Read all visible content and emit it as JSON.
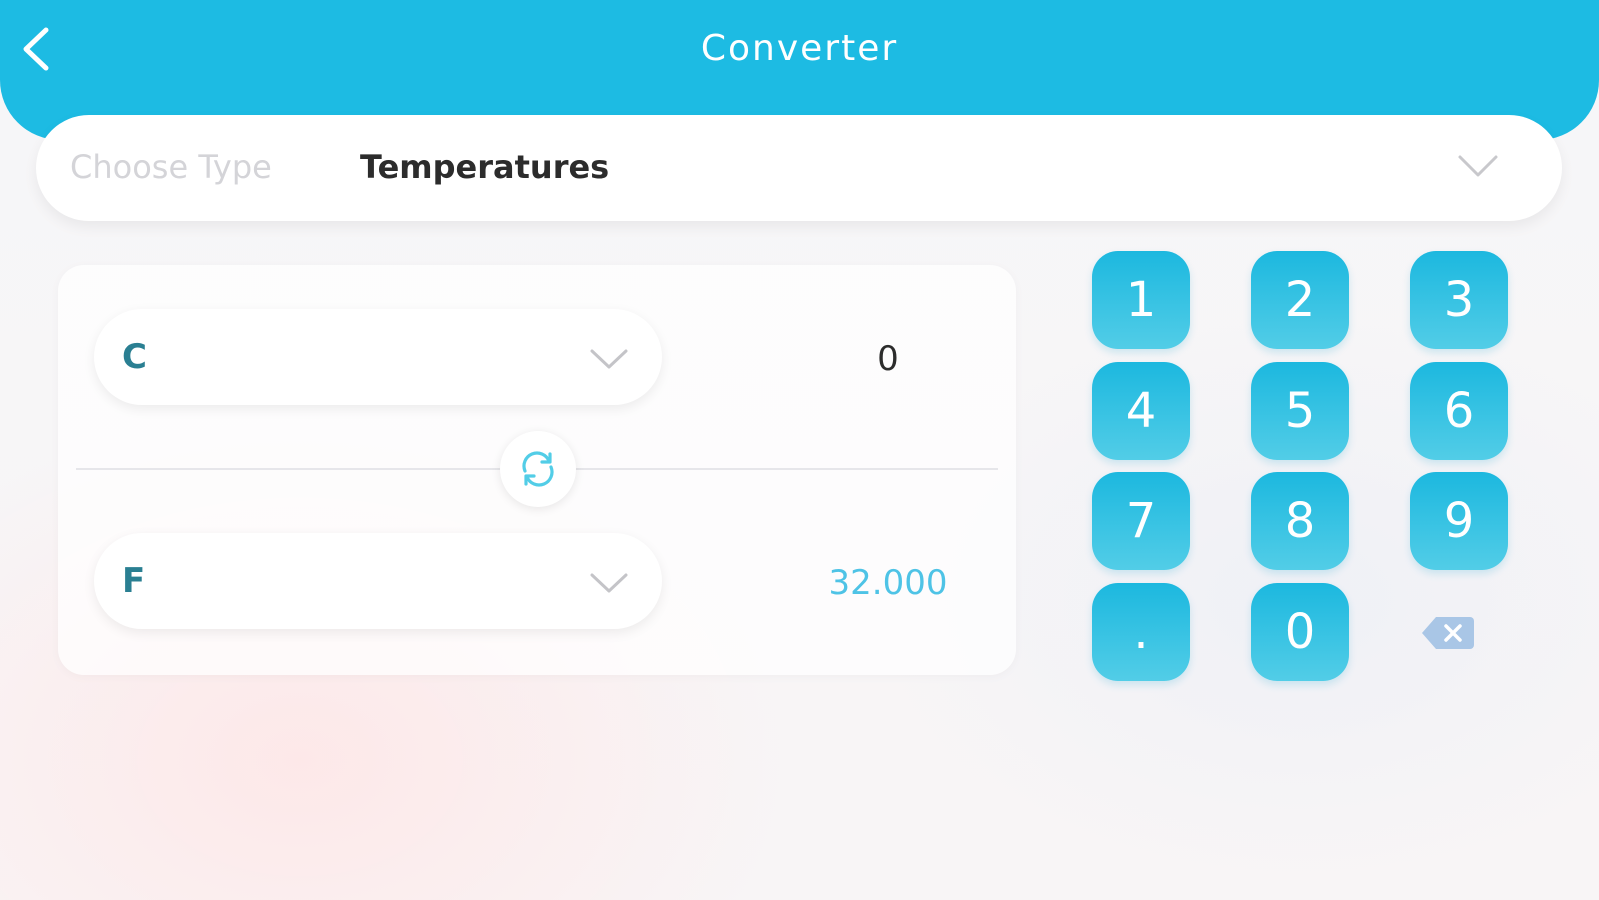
{
  "header": {
    "title": "Converter",
    "back_icon": "chevron-left-icon"
  },
  "type_selector": {
    "label": "Choose Type",
    "value": "Temperatures",
    "icon": "chevron-down-icon"
  },
  "converter": {
    "from_unit": "C",
    "from_value": "0",
    "to_unit": "F",
    "to_value": "32.000",
    "swap_icon": "refresh-icon"
  },
  "keypad": {
    "keys": [
      "1",
      "2",
      "3",
      "4",
      "5",
      "6",
      "7",
      "8",
      "9",
      ".",
      "0"
    ],
    "backspace_icon": "backspace-icon"
  },
  "colors": {
    "accent": "#1dbbe3",
    "result_text": "#4ec3e6",
    "unit_text": "#2a7f92",
    "backspace": "#a9c6e6"
  }
}
